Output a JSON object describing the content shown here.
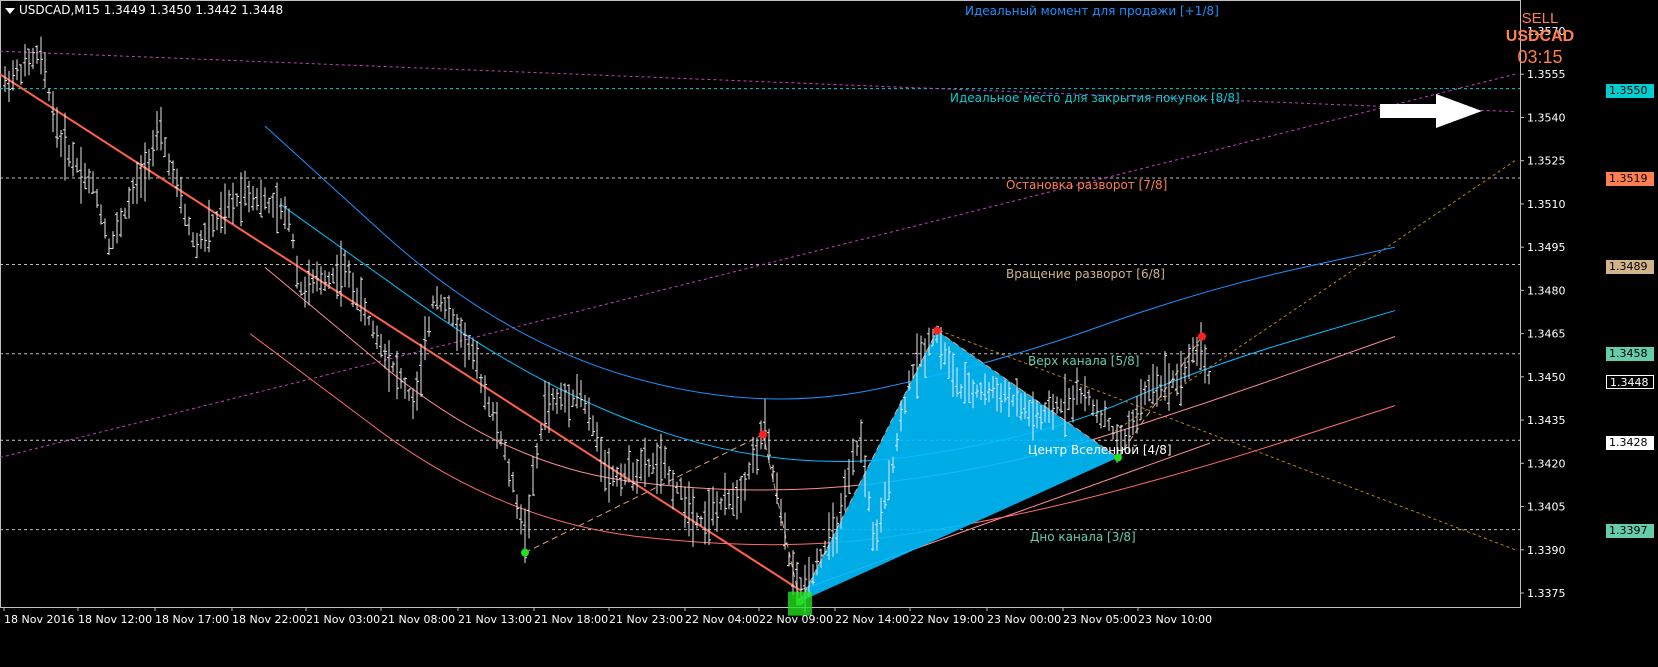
{
  "header": {
    "symbol_info": "USDCAD,M15  1.3449 1.3450 1.3442 1.3448"
  },
  "signal": {
    "direction": "SELL",
    "symbol": "USDCAD",
    "timer": "03:15"
  },
  "levels": [
    {
      "id": "plus18",
      "text": "Идеальный момент для продажи [+1/8]",
      "color": "#1e90ff",
      "price": 1.3579,
      "line": false
    },
    {
      "id": "l88",
      "text": "Идеальное место для закрытия покупок [8/8]",
      "color": "#00ced1",
      "price": 1.355,
      "line": true
    },
    {
      "id": "l78",
      "text": "Остановка разворот [7/8]",
      "color": "#ff7f50",
      "price": 1.3519,
      "line": true
    },
    {
      "id": "l68",
      "text": "Вращение разворот [6/8]",
      "color": "#d2b48c",
      "price": 1.3489,
      "line": true
    },
    {
      "id": "l58",
      "text": "Верх канала [5/8]",
      "color": "#66cdaa",
      "price": 1.3458,
      "line": true
    },
    {
      "id": "l48",
      "text": "Центр Вселенной [4/8]",
      "color": "#ffffff",
      "price": 1.3428,
      "line": true
    },
    {
      "id": "l38",
      "text": "Дно канала [3/8]",
      "color": "#66cdaa",
      "price": 1.3397,
      "line": true
    }
  ],
  "price_tags": [
    {
      "value": "1.3550",
      "bg": "#00ced1",
      "fg": "#000000"
    },
    {
      "value": "1.3519",
      "bg": "#ff7f50",
      "fg": "#000000"
    },
    {
      "value": "1.3489",
      "bg": "#d2b48c",
      "fg": "#000000"
    },
    {
      "value": "1.3458",
      "bg": "#66cdaa",
      "fg": "#000000"
    },
    {
      "value": "1.3448",
      "bg": "#000000",
      "fg": "#ffffff"
    },
    {
      "value": "1.3428",
      "bg": "#ffffff",
      "fg": "#000000"
    },
    {
      "value": "1.3397",
      "bg": "#66cdaa",
      "fg": "#000000"
    }
  ],
  "chart_data": {
    "type": "line",
    "subtype": "candlestick-bars",
    "title": "USDCAD,M15",
    "ylim": [
      1.3368,
      1.358
    ],
    "y_ticks": [
      "1.3570",
      "1.3555",
      "1.3540",
      "1.3525",
      "1.3510",
      "1.3495",
      "1.3480",
      "1.3465",
      "1.3450",
      "1.3435",
      "1.3420",
      "1.3405",
      "1.3390",
      "1.3375"
    ],
    "x_ticks": [
      "18 Nov 2016",
      "18 Nov 12:00",
      "18 Nov 17:00",
      "18 Nov 22:00",
      "21 Nov 03:00",
      "21 Nov 08:00",
      "21 Nov 13:00",
      "21 Nov 18:00",
      "21 Nov 23:00",
      "22 Nov 04:00",
      "22 Nov 09:00",
      "22 Nov 14:00",
      "22 Nov 19:00",
      "23 Nov 00:00",
      "23 Nov 05:00",
      "23 Nov 10:00"
    ],
    "x_range": [
      0,
      1520
    ],
    "price_path": [
      [
        5,
        1.3552
      ],
      [
        40,
        1.3562
      ],
      [
        60,
        1.3532
      ],
      [
        95,
        1.3515
      ],
      [
        110,
        1.3495
      ],
      [
        160,
        1.3535
      ],
      [
        195,
        1.3495
      ],
      [
        245,
        1.3515
      ],
      [
        290,
        1.3505
      ],
      [
        300,
        1.348
      ],
      [
        345,
        1.3487
      ],
      [
        375,
        1.3465
      ],
      [
        415,
        1.344
      ],
      [
        435,
        1.348
      ],
      [
        470,
        1.346
      ],
      [
        500,
        1.343
      ],
      [
        525,
        1.3395
      ],
      [
        545,
        1.344
      ],
      [
        580,
        1.3445
      ],
      [
        610,
        1.3415
      ],
      [
        660,
        1.342
      ],
      [
        700,
        1.34
      ],
      [
        740,
        1.341
      ],
      [
        765,
        1.3432
      ],
      [
        790,
        1.3385
      ],
      [
        800,
        1.3375
      ],
      [
        840,
        1.34
      ],
      [
        860,
        1.343
      ],
      [
        875,
        1.339
      ],
      [
        910,
        1.345
      ],
      [
        935,
        1.3466
      ],
      [
        960,
        1.3445
      ],
      [
        1000,
        1.3445
      ],
      [
        1040,
        1.3435
      ],
      [
        1080,
        1.3445
      ],
      [
        1110,
        1.3433
      ],
      [
        1120,
        1.3425
      ],
      [
        1150,
        1.3447
      ],
      [
        1180,
        1.345
      ],
      [
        1200,
        1.3462
      ],
      [
        1212,
        1.3446
      ]
    ],
    "zigzag": [
      {
        "x": 525,
        "y": 1.3389,
        "kind": "low"
      },
      {
        "x": 763,
        "y": 1.343,
        "kind": "high"
      },
      {
        "x": 800,
        "y": 1.3372,
        "kind": "low"
      },
      {
        "x": 937,
        "y": 1.3466,
        "kind": "high"
      },
      {
        "x": 1118,
        "y": 1.3422,
        "kind": "low"
      },
      {
        "x": 1202,
        "y": 1.3464,
        "kind": "high"
      }
    ],
    "pattern_triangles": [
      {
        "points": [
          [
            800,
            1.3372
          ],
          [
            937,
            1.3466
          ],
          [
            1118,
            1.3422
          ]
        ],
        "color": "#00bfff"
      }
    ],
    "trend_lines": [
      {
        "from": [
          0,
          1.3555
        ],
        "to": [
          800,
          1.3376
        ],
        "color": "#ff6347",
        "width": 2
      },
      {
        "from": [
          800,
          1.3376
        ],
        "to": [
          1210,
          1.3427
        ],
        "color": "#ff8c94",
        "width": 1
      },
      {
        "from": [
          0,
          1.3422
        ],
        "to": [
          1515,
          1.3555
        ],
        "color": "#c040c0",
        "dashed": true
      },
      {
        "from": [
          0,
          1.3563
        ],
        "to": [
          1515,
          1.3542
        ],
        "color": "#c040c0",
        "dashed": true
      },
      {
        "from": [
          1110,
          1.343
        ],
        "to": [
          1515,
          1.3525
        ],
        "color": "#b8860b",
        "dashed": true
      },
      {
        "from": [
          940,
          1.3466
        ],
        "to": [
          1515,
          1.339
        ],
        "color": "#b8860b",
        "dashed": true
      }
    ],
    "curves": [
      {
        "points": [
          [
            265,
            1.3537
          ],
          [
            500,
            1.3463
          ],
          [
            760,
            1.3437
          ],
          [
            1000,
            1.3455
          ],
          [
            1200,
            1.348
          ],
          [
            1395,
            1.3495
          ]
        ],
        "color": "#1e90ff"
      },
      {
        "points": [
          [
            280,
            1.351
          ],
          [
            550,
            1.3443
          ],
          [
            800,
            1.3416
          ],
          [
            1050,
            1.343
          ],
          [
            1200,
            1.3453
          ],
          [
            1395,
            1.3473
          ]
        ],
        "color": "#00bfff"
      },
      {
        "points": [
          [
            265,
            1.3488
          ],
          [
            500,
            1.342
          ],
          [
            750,
            1.3408
          ],
          [
            1000,
            1.3418
          ],
          [
            1200,
            1.344
          ],
          [
            1395,
            1.3464
          ]
        ],
        "color": "#ff8c94"
      },
      {
        "points": [
          [
            250,
            1.3465
          ],
          [
            500,
            1.34
          ],
          [
            780,
            1.3389
          ],
          [
            1000,
            1.34
          ],
          [
            1200,
            1.3418
          ],
          [
            1395,
            1.344
          ]
        ],
        "color": "#ff6b6b"
      }
    ]
  }
}
